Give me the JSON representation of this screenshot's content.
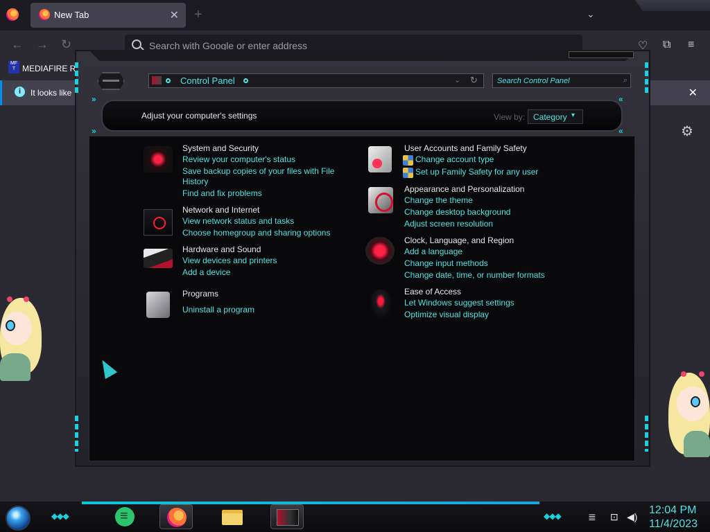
{
  "browser": {
    "tab_title": "New Tab",
    "tab_close": "✕",
    "new_tab": "+",
    "tab_list": "⌄",
    "back": "←",
    "forward": "→",
    "reload": "↻",
    "url_placeholder": "Search with Google or enter address",
    "pocket": "♡",
    "extensions": "⧉",
    "menu": "≡",
    "bookmark_icon_text": "MF T",
    "bookmark_label": "MEDIAFIRE RO",
    "notice_icon": "i",
    "notice_text": "It looks like",
    "notice_close": "✕",
    "gear": "⚙"
  },
  "control_panel": {
    "address": "Control Panel",
    "addr_chevron": "⌄",
    "addr_refresh": "↻",
    "search_placeholder": "Search Control Panel",
    "search_icon": "⌕",
    "header_title": "Adjust your computer's settings",
    "view_by_label": "View by:",
    "view_by_value": "Category",
    "view_by_arrow": "▾",
    "chevrons": "»",
    "chevrons_left": "«",
    "left_column": [
      {
        "title": "System and Security",
        "icon": "shield-icon",
        "links": [
          "Review your computer's status",
          "Save backup copies of your files with File",
          "History",
          "Find and fix problems"
        ]
      },
      {
        "title": "Network and Internet",
        "icon": "network-icon",
        "links": [
          "View network status and tasks",
          "Choose homegroup and sharing options"
        ]
      },
      {
        "title": "Hardware and Sound",
        "icon": "printer-icon",
        "links": [
          "View devices and printers",
          "Add a device"
        ]
      },
      {
        "title": "Programs",
        "icon": "programs-icon",
        "links": [
          "Uninstall a program"
        ]
      }
    ],
    "right_column": [
      {
        "title": "User Accounts and Family Safety",
        "icon": "users-icon",
        "links": [
          "Change account type",
          "Set up Family Safety for any user"
        ]
      },
      {
        "title": "Appearance and Personalization",
        "icon": "appearance-icon",
        "links": [
          "Change the theme",
          "Change desktop background",
          "Adjust screen resolution"
        ]
      },
      {
        "title": "Clock, Language, and Region",
        "icon": "clock-icon",
        "links": [
          "Add a language",
          "Change input methods",
          "Change date, time, or number formats"
        ]
      },
      {
        "title": "Ease of Access",
        "icon": "ease-of-access-icon",
        "links": [
          "Let Windows suggest settings",
          "Optimize visual display"
        ]
      }
    ]
  },
  "taskbar": {
    "time": "12:04 PM",
    "date": "11/4/2023",
    "network": "⊡",
    "volume": "◀)",
    "show_desktop": "≣"
  },
  "colors": {
    "link": "#4fe3e3",
    "accent": "#1ad0e0",
    "window_bg": "#09090b"
  }
}
